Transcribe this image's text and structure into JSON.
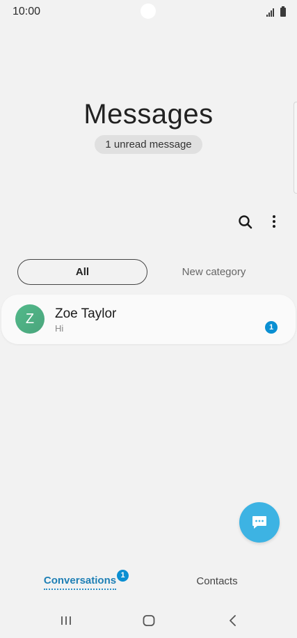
{
  "status_bar": {
    "time": "10:00"
  },
  "header": {
    "title": "Messages",
    "unread_label": "1 unread message"
  },
  "toolbar": {
    "search_icon": "search-icon",
    "more_icon": "more-vert-icon"
  },
  "categories": [
    {
      "label": "All",
      "selected": true
    },
    {
      "label": "New category",
      "selected": false
    }
  ],
  "conversations": [
    {
      "avatar_initial": "Z",
      "name": "Zoe Taylor",
      "preview": "Hi",
      "unread_count": "1"
    }
  ],
  "fab": {
    "icon": "compose-message-icon"
  },
  "bottom_tabs": [
    {
      "label": "Conversations",
      "badge": "1",
      "selected": true
    },
    {
      "label": "Contacts",
      "selected": false
    }
  ],
  "nav_bar": [
    "recent-apps-icon",
    "home-icon",
    "back-icon"
  ],
  "colors": {
    "accent": "#0a8fd2",
    "fab": "#3db3e3",
    "avatar": "#52b98a",
    "background": "#f2f2f2"
  }
}
